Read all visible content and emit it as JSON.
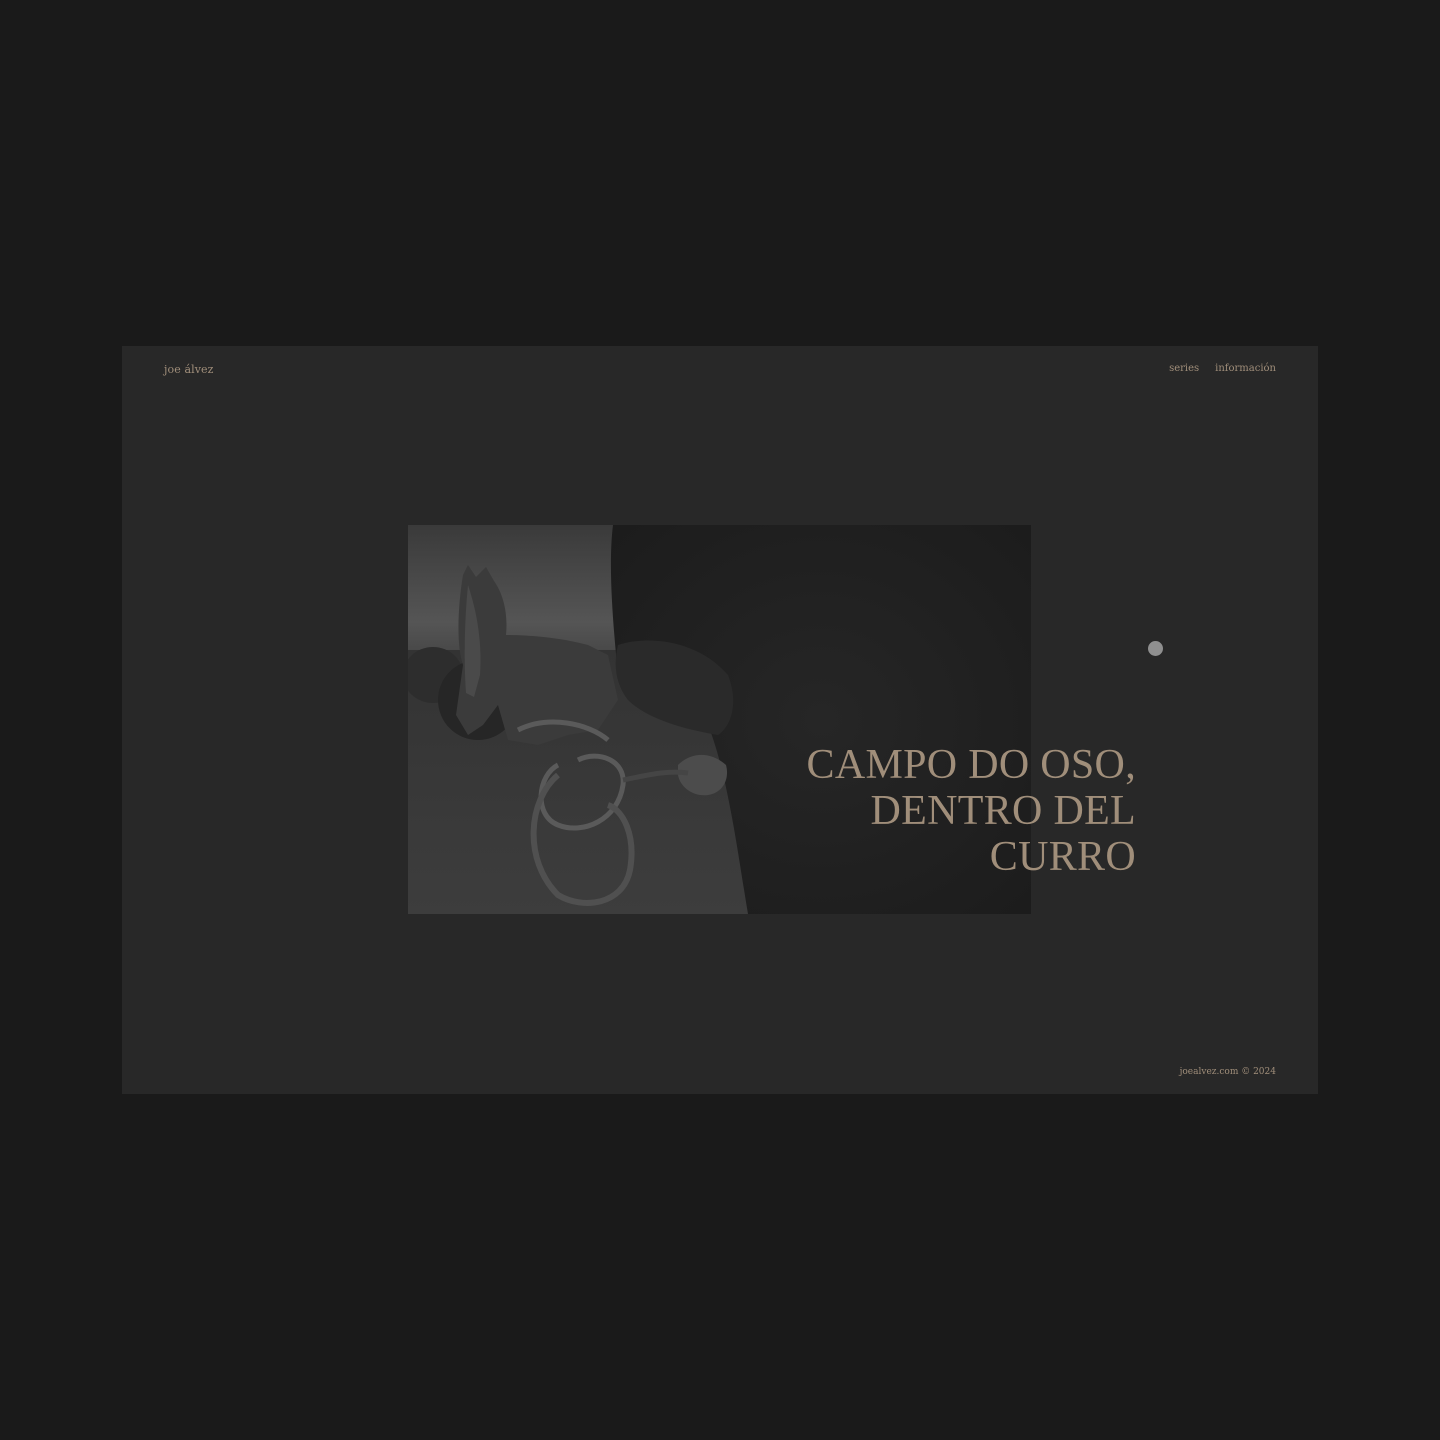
{
  "header": {
    "brand": "joe álvez",
    "nav": [
      {
        "label": "series"
      },
      {
        "label": "información"
      }
    ]
  },
  "hero": {
    "title_lines": [
      "CAMPO DO OSO,",
      "DENTRO DEL",
      "CURRO"
    ],
    "photo_subject": "black-and-white photo: horses in a corral, a hand holding a horse halter"
  },
  "carousel": {
    "indicator": "slide-indicator-dot"
  },
  "footer": {
    "copyright": "joealvez.com © 2024"
  },
  "colors": {
    "page_background": "#1a1a1a",
    "screen_background": "#282828",
    "accent_text": "#a08e7a",
    "indicator_dot": "#8f8f8f"
  }
}
